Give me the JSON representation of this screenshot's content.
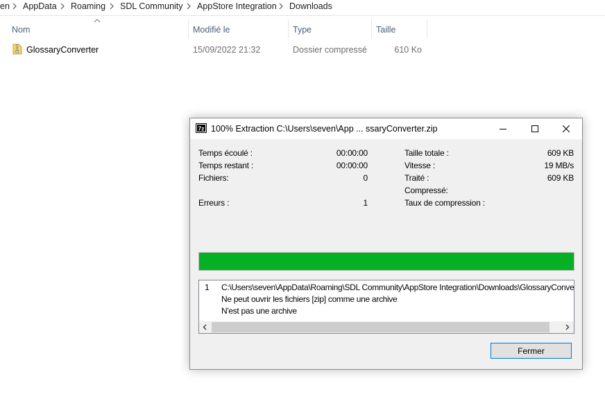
{
  "breadcrumb": {
    "items": [
      "en",
      "AppData",
      "Roaming",
      "SDL Community",
      "AppStore Integration",
      "Downloads"
    ]
  },
  "columns": {
    "name": "Nom",
    "modified": "Modifié le",
    "type": "Type",
    "size": "Taille"
  },
  "files": [
    {
      "icon": "zip-folder-icon",
      "name": "GlossaryConverter",
      "modified": "15/09/2022 21:32",
      "type": "Dossier compressé",
      "size": "610 Ko"
    }
  ],
  "dialog": {
    "icon": "7zip-icon",
    "title": "100% Extraction C:\\Users\\seven\\App ... ssaryConverter.zip",
    "stats_left": [
      {
        "label": "Temps écoulé :",
        "value": "00:00:00"
      },
      {
        "label": "Temps restant :",
        "value": "00:00:00"
      },
      {
        "label": "Fichiers:",
        "value": "0"
      },
      {
        "label": "Erreurs :",
        "value": "1"
      }
    ],
    "stats_right": [
      {
        "label": "Taille totale :",
        "value": "609 KB"
      },
      {
        "label": "Vitesse :",
        "value": "19 MB/s"
      },
      {
        "label": "Traité :",
        "value": "609 KB"
      },
      {
        "label": "Compressé:",
        "value": ""
      },
      {
        "label": "Taux de compression :",
        "value": ""
      }
    ],
    "progress_percent": 100,
    "progress_color": "#06b025",
    "messages": {
      "index": "1",
      "path": "C:\\Users\\seven\\AppData\\Roaming\\SDL Community\\AppStore Integration\\Downloads\\GlossaryConverter.z",
      "line1": "Ne peut ouvrir les fichiers [zip] comme une archive",
      "line2": "N'est pas une archive"
    },
    "close_button": "Fermer"
  }
}
